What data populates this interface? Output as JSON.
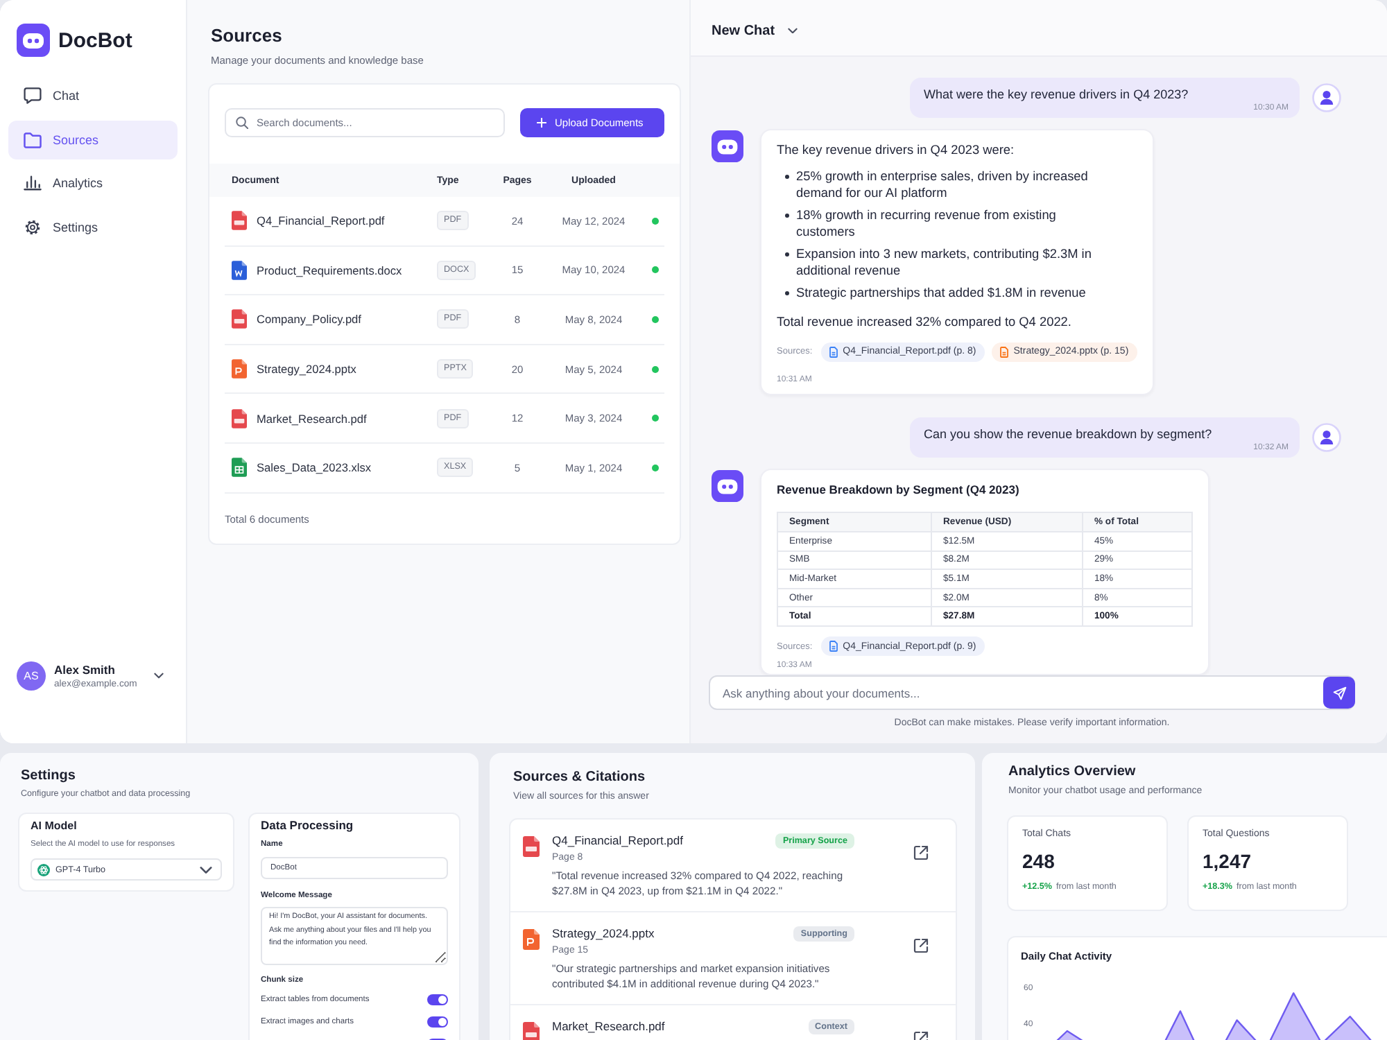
{
  "sidebar": {
    "brand": "DocBot",
    "nav": [
      {
        "label": "Chat",
        "selected": false
      },
      {
        "label": "Sources",
        "selected": true
      },
      {
        "label": "Analytics",
        "selected": false
      },
      {
        "label": "Settings",
        "selected": false
      }
    ],
    "user": {
      "initials": "AS",
      "name": "Alex Smith",
      "email": "alex@example.com"
    }
  },
  "sources": {
    "title": "Sources",
    "subtitle": "Manage your documents and knowledge base",
    "search": {
      "placeholder": "Search documents..."
    },
    "upload_button": "Upload Documents",
    "columns": [
      "Document",
      "Type",
      "Pages",
      "Uploaded"
    ],
    "rows": [
      {
        "kind": "pdf",
        "name": "Q4_Financial_Report.pdf",
        "type": "PDF",
        "pages": "24",
        "uploaded": "May 12, 2024",
        "indexed": true
      },
      {
        "kind": "docx",
        "name": "Product_Requirements.docx",
        "type": "DOCX",
        "pages": "15",
        "uploaded": "May 10, 2024",
        "indexed": true
      },
      {
        "kind": "pdf",
        "name": "Company_Policy.pdf",
        "type": "PDF",
        "pages": "8",
        "uploaded": "May 8, 2024",
        "indexed": true
      },
      {
        "kind": "pptx",
        "name": "Strategy_2024.pptx",
        "type": "PPTX",
        "pages": "20",
        "uploaded": "May 5, 2024",
        "indexed": true
      },
      {
        "kind": "pdf",
        "name": "Market_Research.pdf",
        "type": "PDF",
        "pages": "12",
        "uploaded": "May 3, 2024",
        "indexed": true
      },
      {
        "kind": "xlsx",
        "name": "Sales_Data_2023.xlsx",
        "type": "XLSX",
        "pages": "5",
        "uploaded": "May 1, 2024",
        "indexed": true
      }
    ],
    "footer": "Total 6 documents"
  },
  "chat": {
    "title": "New Chat",
    "messages": [
      {
        "kind": "user",
        "text": "What were the key revenue drivers in Q4 2023?",
        "time": "10:30 AM"
      },
      {
        "kind": "bot",
        "intro": "The key revenue drivers in Q4 2023 were:",
        "bullets": [
          "25% growth in enterprise sales, driven by increased demand for our AI platform",
          "18% growth in recurring revenue from existing customers",
          "Expansion into 3 new markets, contributing $2.3M in additional revenue",
          "Strategic partnerships that added $1.8M in revenue"
        ],
        "summary": "Total revenue increased 32% compared to Q4 2022.",
        "sources_label": "Sources:",
        "sources": [
          {
            "kind": "pdf",
            "label": "Q4_Financial_Report.pdf (p. 8)"
          },
          {
            "kind": "pptx",
            "label": "Strategy_2024.pptx (p. 15)"
          }
        ],
        "time": "10:31 AM"
      },
      {
        "kind": "user",
        "text": "Can you show the revenue breakdown by segment?",
        "time": "10:32 AM"
      },
      {
        "kind": "bot",
        "table_title": "Revenue Breakdown by Segment (Q4 2023)",
        "table": {
          "columns": [
            "Segment",
            "Revenue (USD)",
            "% of Total"
          ],
          "rows": [
            {
              "cells": [
                "Enterprise",
                "$12.5M",
                "45%"
              ],
              "total": false
            },
            {
              "cells": [
                "SMB",
                "$8.2M",
                "29%"
              ],
              "total": false
            },
            {
              "cells": [
                "Mid-Market",
                "$5.1M",
                "18%"
              ],
              "total": false
            },
            {
              "cells": [
                "Other",
                "$2.0M",
                "8%"
              ],
              "total": false
            },
            {
              "cells": [
                "Total",
                "$27.8M",
                "100%"
              ],
              "total": true
            }
          ]
        },
        "sources_label": "Sources:",
        "sources": [
          {
            "kind": "pdf",
            "label": "Q4_Financial_Report.pdf (p. 9)"
          }
        ],
        "time": "10:33 AM"
      }
    ],
    "input": {
      "placeholder": "Ask anything about your documents..."
    },
    "disclaimer": "DocBot can make mistakes. Please verify important information."
  },
  "settings": {
    "title": "Settings",
    "subtitle": "Configure your chatbot and data processing",
    "model_card": {
      "title": "AI Model",
      "hint": "Select the AI model to use for responses",
      "model": "GPT-4 Turbo"
    },
    "data_card": {
      "title": "Data Processing",
      "name_field": {
        "label": "Name",
        "value": "DocBot"
      },
      "welcome_field": {
        "label": "Welcome Message",
        "value": "Hi! I'm DocBot, your AI assistant for documents. Ask me anything about your files and I'll help you find the information you need."
      },
      "chunk_label": "Chunk size",
      "toggles": [
        {
          "label": "Extract tables from documents",
          "on": true
        },
        {
          "label": "Extract images and charts",
          "on": true
        },
        {
          "on": true
        }
      ]
    }
  },
  "citations": {
    "title": "Sources & Citations",
    "subtitle": "View all sources for this answer",
    "items": [
      {
        "kind": "pdf",
        "name": "Q4_Financial_Report.pdf",
        "tag": {
          "label": "Primary Source",
          "color": "#16a34a"
        },
        "page": "Page 8",
        "quote": "\"Total revenue increased 32% compared to Q4 2022, reaching $27.8M in Q4 2023, up from $21.1M in Q4 2022.\""
      },
      {
        "kind": "pptx",
        "name": "Strategy_2024.pptx",
        "tag": {
          "label": "Supporting",
          "color": "#64748b"
        },
        "page": "Page 15",
        "quote": "\"Our strategic partnerships and market expansion initiatives contributed $4.1M in additional revenue during Q4 2023.\""
      },
      {
        "kind": "pdf",
        "name": "Market_Research.pdf",
        "tag": {
          "label": "Context",
          "color": "#64748b"
        }
      }
    ]
  },
  "analytics": {
    "title": "Analytics Overview",
    "subtitle": "Monitor your chatbot usage and performance",
    "stats": [
      {
        "label": "Total Chats",
        "value": "248",
        "change": "+12.5%",
        "note": "from last month"
      },
      {
        "label": "Total Questions",
        "value": "1,247",
        "change": "+18.3%",
        "note": "from last month"
      }
    ],
    "chart": {
      "title": "Daily Chat Activity",
      "y_labels": [
        "60",
        "40"
      ]
    }
  }
}
